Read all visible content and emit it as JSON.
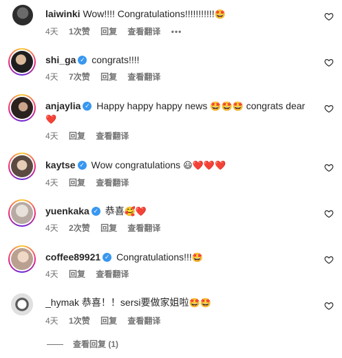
{
  "comments": [
    {
      "username": "laiwinki",
      "verified": false,
      "text": "Wow!!!! Congratulations!!!!!!!!!!!",
      "emojis": "🤩",
      "age": "4天",
      "likes": "1次赞",
      "reply": "回复",
      "translate": "查看翻译",
      "more": "•••"
    },
    {
      "username": "shi_ga",
      "verified": true,
      "text": "congrats!!!!",
      "emojis": "",
      "age": "4天",
      "likes": "7次赞",
      "reply": "回复",
      "translate": "查看翻译"
    },
    {
      "username": "anjaylia",
      "verified": true,
      "text": "Happy happy happy news",
      "emojis": "🤩🤩🤩",
      "text2": "congrats dear",
      "emojis2": "❤️",
      "age": "4天",
      "reply": "回复",
      "translate": "查看翻译"
    },
    {
      "username": "kaytse",
      "verified": true,
      "text": "Wow congratulations",
      "emojis": "😃❤️❤️❤️",
      "age": "4天",
      "reply": "回复",
      "translate": "查看翻译"
    },
    {
      "username": "yuenkaka",
      "verified": true,
      "text": "恭喜",
      "emojis": "🥰❤️",
      "age": "4天",
      "likes": "2次赞",
      "reply": "回复",
      "translate": "查看翻译"
    },
    {
      "username": "coffee89921",
      "verified": true,
      "text": "Congratulations!!!",
      "emojis": "🤩",
      "age": "4天",
      "reply": "回复",
      "translate": "查看翻译"
    },
    {
      "username": "_hymak",
      "verified": false,
      "text": "恭喜！！sersi要做家姐啦",
      "emojis": "🤩🤩",
      "age": "4天",
      "likes": "1次赞",
      "reply": "回复",
      "translate": "查看翻译"
    }
  ],
  "view_replies": "查看回复 (1)",
  "colors": {
    "text": "#262626",
    "meta": "#737373",
    "verified": "#3897f0"
  }
}
